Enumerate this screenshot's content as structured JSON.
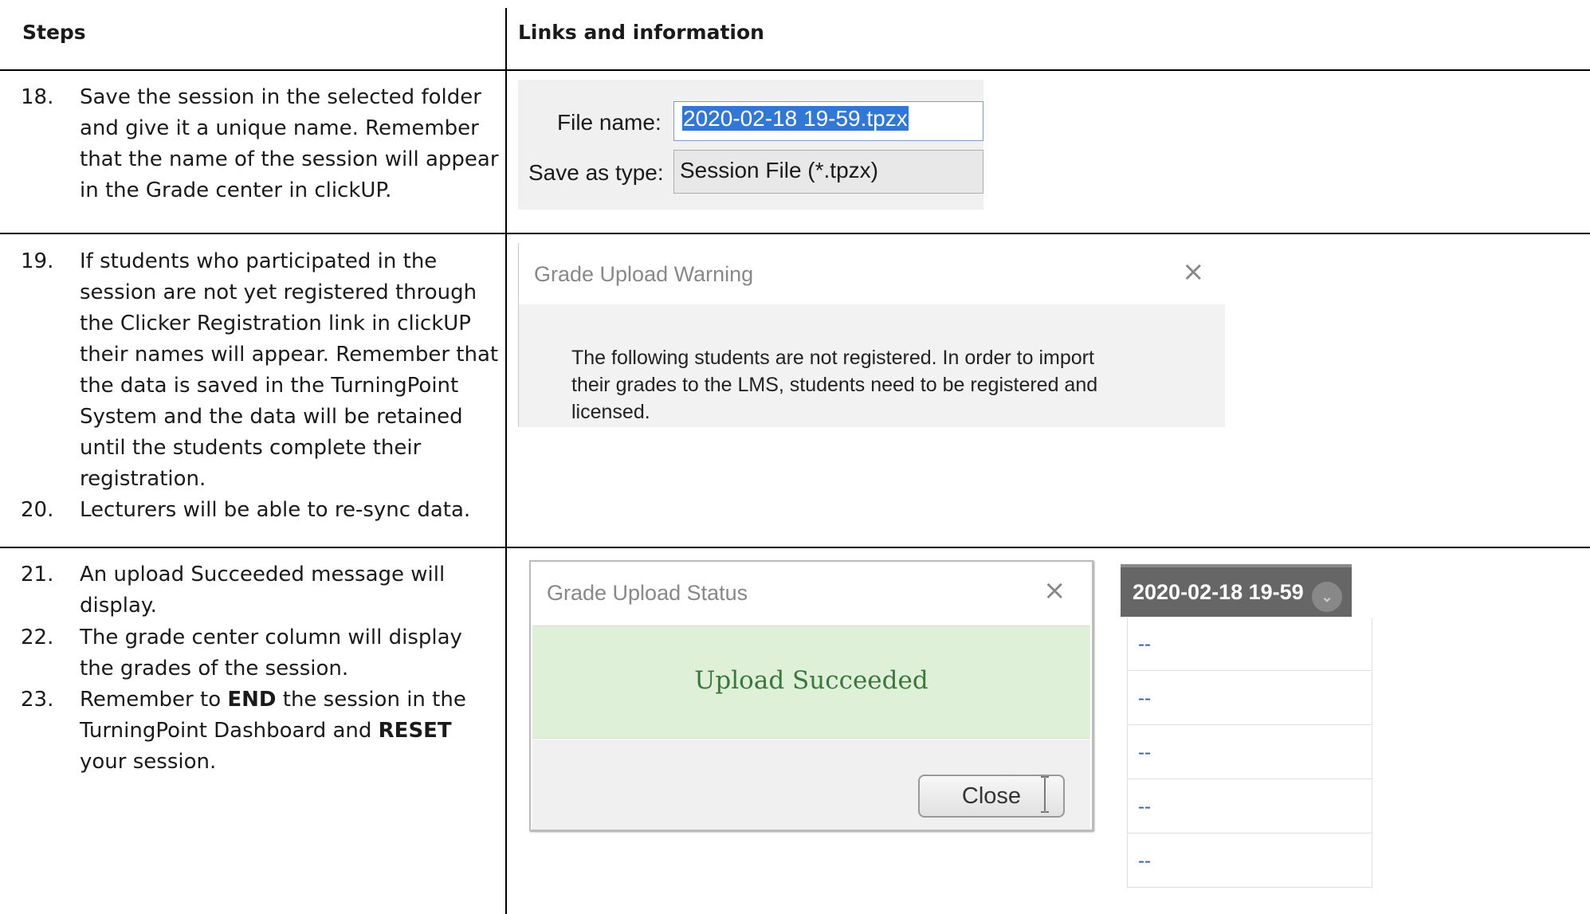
{
  "header": {
    "steps": "Steps",
    "links": "Links and information"
  },
  "steps": [
    {
      "num": "18.",
      "text": "Save the session in the selected folder and give it a unique name. Remember that the name of the session will appear in the Grade center in clickUP."
    },
    {
      "num": "19.",
      "text": "If students who participated in the session are not yet registered through the Clicker Registration link in clickUP their names will appear. Remember that the data is saved in the TurningPoint System and the data will be retained until the students complete their registration."
    },
    {
      "num": "20.",
      "text": "Lecturers will be able to re-sync data."
    },
    {
      "num": "21.",
      "text": "An upload Succeeded message will display."
    },
    {
      "num": "22.",
      "text": "The grade center column will display the grades of the session."
    },
    {
      "num": "23.",
      "pre": "Remember to ",
      "b1": "END",
      "mid": " the session in the TurningPoint Dashboard and ",
      "b2": "RESET",
      "post": " your session."
    }
  ],
  "save_dialog": {
    "file_name_label": "File name:",
    "file_name_value": "2020-02-18 19-59.tpzx",
    "save_type_label": "Save as type:",
    "save_type_value": "Session File (*.tpzx)"
  },
  "warning_dialog": {
    "title": "Grade Upload Warning",
    "close": "×",
    "message": "The following students are not registered. In order to import their grades to the LMS, students need to be registered and licensed."
  },
  "status_dialog": {
    "title": "Grade Upload Status",
    "close": "×",
    "status": "Upload Succeeded",
    "button": "Close"
  },
  "grade_column": {
    "header": "2020-02-18 19-59",
    "cells": [
      "--",
      "--",
      "--",
      "--",
      "--"
    ]
  }
}
